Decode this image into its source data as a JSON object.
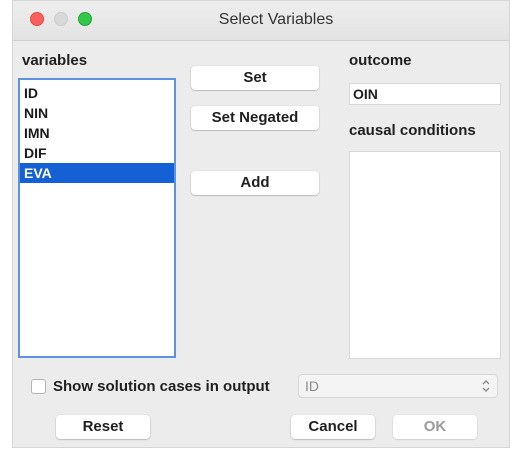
{
  "window": {
    "title": "Select Variables"
  },
  "variables": {
    "label": "variables",
    "items": [
      "ID",
      "NIN",
      "IMN",
      "DIF",
      "EVA"
    ],
    "selected": "EVA"
  },
  "buttons": {
    "set": "Set",
    "set_negated": "Set Negated",
    "add": "Add",
    "reset": "Reset",
    "cancel": "Cancel",
    "ok": "OK"
  },
  "outcome": {
    "label": "outcome",
    "value": "OIN"
  },
  "causal_conditions": {
    "label": "causal conditions",
    "items": []
  },
  "solution_cases": {
    "checkbox_label": "Show solution cases in output",
    "checked": false,
    "select_value": "ID"
  },
  "colors": {
    "selection": "#1560d4",
    "focus_ring": "#5c93e0",
    "close": "#fc605c",
    "zoom": "#34c84a"
  },
  "icons": [
    "close-window-icon",
    "minimize-window-icon",
    "zoom-window-icon",
    "up-down-chevron-icon"
  ]
}
